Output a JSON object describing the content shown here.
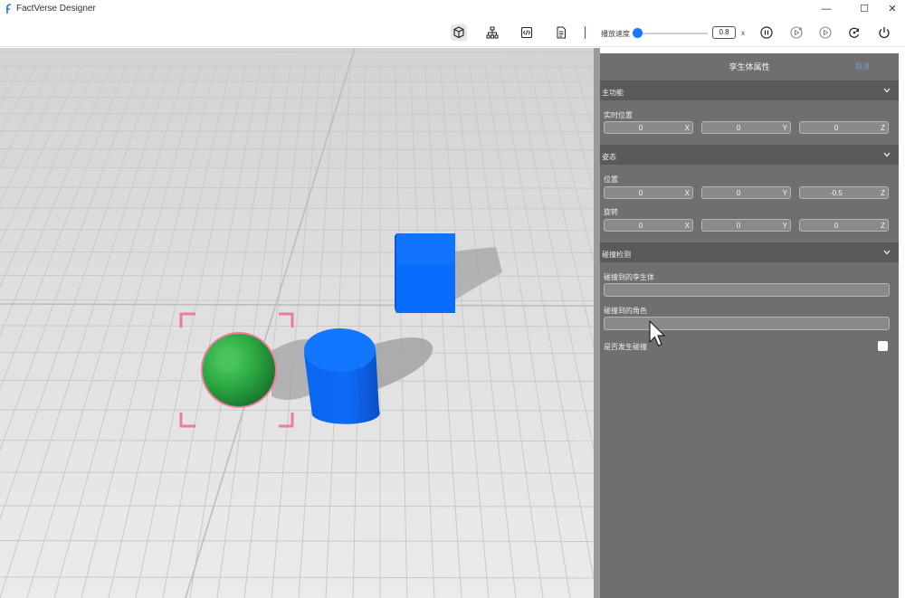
{
  "window": {
    "title": "FactVerse Designer",
    "minimize_glyph": "—",
    "maximize_glyph": "☐",
    "close_glyph": "✕"
  },
  "toolbar": {
    "icons": [
      "cube-icon",
      "hierarchy-icon",
      "code-icon",
      "document-icon"
    ],
    "speed_label": "播放速度",
    "speed_value": "0.8",
    "speed_unit": "x",
    "slider_fraction": 0.0,
    "playback_icons": [
      "pause-icon",
      "play-step-icon",
      "play-icon",
      "reset-icon",
      "power-icon"
    ]
  },
  "panel": {
    "title": "孪生体属性",
    "close_label": "取消",
    "main_section": "主功能",
    "realtime_label": "实时位置",
    "realtime": [
      {
        "value": "0",
        "axis": "X"
      },
      {
        "value": "0",
        "axis": "Y"
      },
      {
        "value": "0",
        "axis": "Z"
      }
    ],
    "pose_section": "姿态",
    "position_label": "位置",
    "position": [
      {
        "value": "0",
        "axis": "X"
      },
      {
        "value": "0",
        "axis": "Y"
      },
      {
        "value": "-0.5",
        "axis": "Z"
      }
    ],
    "rotation_label": "旋转",
    "rotation": [
      {
        "value": "0",
        "axis": "X"
      },
      {
        "value": "0",
        "axis": "Y"
      },
      {
        "value": "0",
        "axis": "Z"
      }
    ],
    "collision_section": "碰撞检测",
    "collided_twin_label": "碰撞到的孪生体",
    "collided_twin_value": "",
    "collided_role_label": "碰撞到的角色",
    "collided_role_value": "",
    "collision_happened_label": "是否发生碰撞",
    "collision_happened": false
  },
  "colors": {
    "accent": "#1677ff",
    "sphere": "#2fb34a",
    "selection": "#f07a9a",
    "cube": "#0a6cff",
    "cylinder": "#0a64f5",
    "panel_bg": "#6f6f6f"
  }
}
